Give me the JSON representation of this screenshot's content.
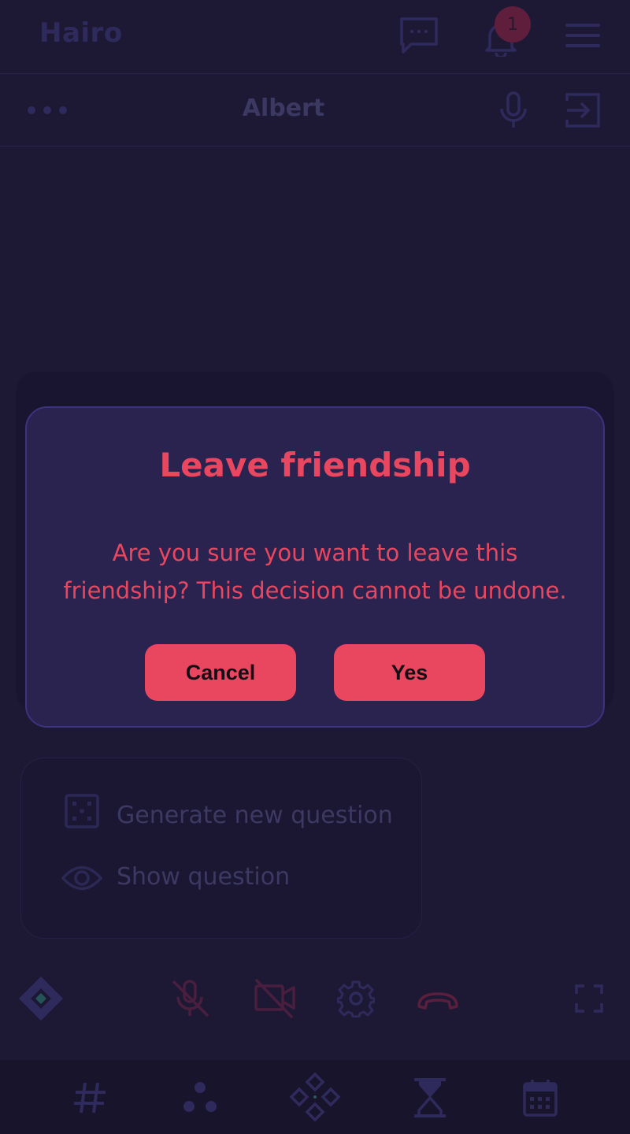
{
  "header": {
    "logo": "Hairo",
    "notification_count": "1"
  },
  "subheader": {
    "contact_name": "Albert"
  },
  "modal": {
    "title": "Leave friendship",
    "message": "Are you sure you want to leave this friendship? This decision cannot be undone.",
    "cancel_label": "Cancel",
    "confirm_label": "Yes"
  },
  "question_panel": {
    "generate_label": "Generate new question",
    "show_label": "Show question"
  },
  "colors": {
    "accent": "#e8475f",
    "background": "#1d1935",
    "modal_bg": "#2a2350",
    "muted": "#3c3962"
  }
}
